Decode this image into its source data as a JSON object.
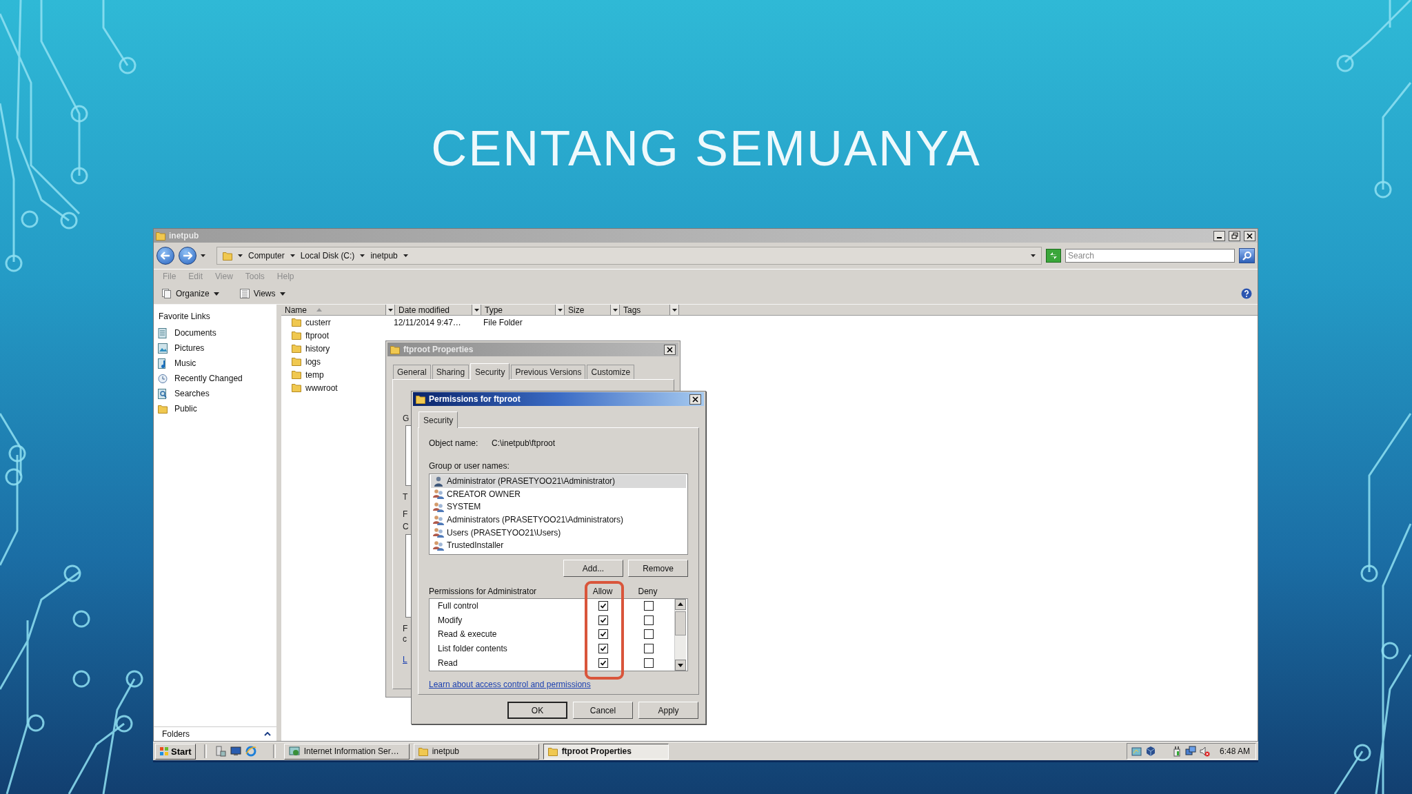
{
  "slide": {
    "title": "CENTANG SEMUANYA"
  },
  "explorer": {
    "title": "inetpub",
    "breadcrumb": [
      "Computer",
      "Local Disk (C:)",
      "inetpub"
    ],
    "search": {
      "placeholder": "Search"
    },
    "menu": [
      {
        "label": "File",
        "disabled": true
      },
      {
        "label": "Edit",
        "disabled": true
      },
      {
        "label": "View",
        "disabled": true
      },
      {
        "label": "Tools",
        "disabled": true
      },
      {
        "label": "Help",
        "disabled": true
      }
    ],
    "toolbar": [
      "Organize",
      "Views"
    ],
    "sidebar": {
      "heading": "Favorite Links",
      "items": [
        "Documents",
        "Pictures",
        "Music",
        "Recently Changed",
        "Searches",
        "Public"
      ],
      "folders_label": "Folders"
    },
    "columns": [
      "Name",
      "Date modified",
      "Type",
      "Size",
      "Tags"
    ],
    "files": [
      {
        "name": "custerr",
        "date_modified": "12/11/2014 9:47…",
        "type": "File Folder"
      },
      {
        "name": "ftproot"
      },
      {
        "name": "history"
      },
      {
        "name": "logs"
      },
      {
        "name": "temp"
      },
      {
        "name": "wwwroot"
      }
    ]
  },
  "properties_dialog": {
    "title": "ftproot Properties",
    "tabs": [
      {
        "label": "General",
        "selected": false
      },
      {
        "label": "Sharing",
        "selected": false
      },
      {
        "label": "Security",
        "selected": true
      },
      {
        "label": "Previous Versions",
        "selected": false
      },
      {
        "label": "Customize",
        "selected": false
      }
    ],
    "fragments": [
      {
        "text": "G",
        "kind": "label"
      },
      {
        "text": "T",
        "kind": "label"
      },
      {
        "text": "F",
        "kind": "label"
      },
      {
        "text": "C",
        "kind": "label"
      },
      {
        "text": "F",
        "kind": "label"
      },
      {
        "text": "c",
        "kind": "label"
      },
      {
        "text": "L",
        "kind": "link"
      }
    ]
  },
  "permissions_dialog": {
    "title": "Permissions for ftproot",
    "tabs": [
      {
        "label": "Security",
        "selected": true
      }
    ],
    "object_name_label": "Object name:",
    "object_name": "C:\\inetpub\\ftproot",
    "group_label": "Group or user names:",
    "principals": [
      {
        "name": "Administrator (PRASETYOO21\\Administrator)",
        "kind": "user",
        "selected": true
      },
      {
        "name": "CREATOR OWNER",
        "kind": "group",
        "selected": false
      },
      {
        "name": "SYSTEM",
        "kind": "group",
        "selected": false
      },
      {
        "name": "Administrators (PRASETYOO21\\Administrators)",
        "kind": "group",
        "selected": false
      },
      {
        "name": "Users (PRASETYOO21\\Users)",
        "kind": "group",
        "selected": false
      },
      {
        "name": "TrustedInstaller",
        "kind": "group",
        "selected": false
      }
    ],
    "list_buttons": [
      "Add...",
      "Remove"
    ],
    "permissions_label": "Permissions for Administrator",
    "allow_label": "Allow",
    "deny_label": "Deny",
    "permissions": [
      {
        "label": "Full control",
        "allow": true,
        "deny": false
      },
      {
        "label": "Modify",
        "allow": true,
        "deny": false
      },
      {
        "label": "Read & execute",
        "allow": true,
        "deny": false
      },
      {
        "label": "List folder contents",
        "allow": true,
        "deny": false
      },
      {
        "label": "Read",
        "allow": true,
        "deny": false
      }
    ],
    "link": "Learn about access control and permissions",
    "buttons": [
      "OK",
      "Cancel",
      "Apply"
    ]
  },
  "taskbar": {
    "start": "Start",
    "tasks": [
      {
        "label": "Internet Information Ser…",
        "selected": false
      },
      {
        "label": "inetpub",
        "selected": false
      },
      {
        "label": "ftproot Properties",
        "selected": true
      }
    ],
    "clock": "6:48 AM"
  }
}
